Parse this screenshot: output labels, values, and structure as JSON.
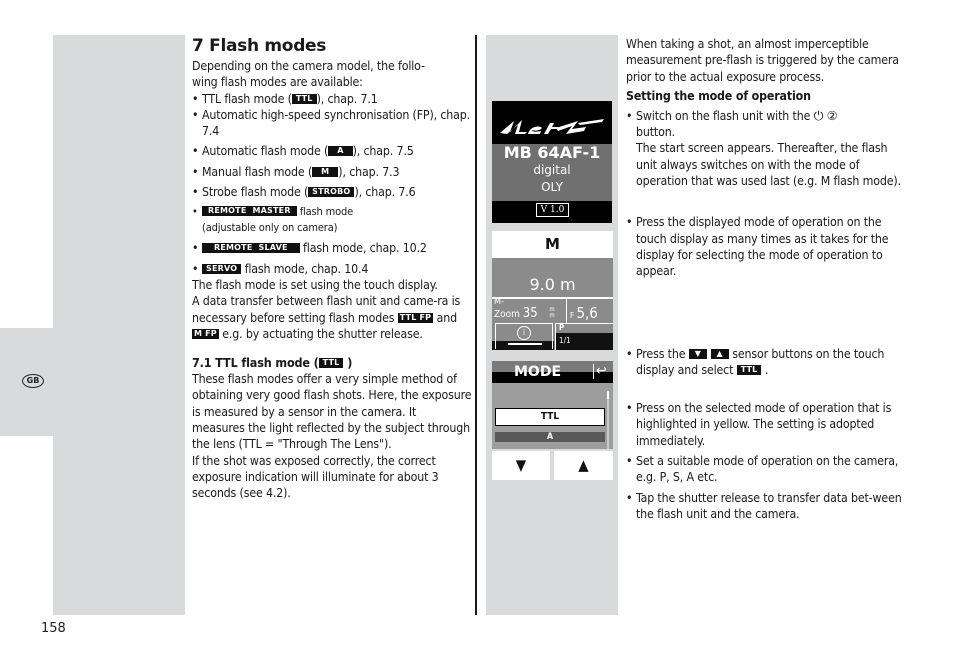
{
  "page": {
    "page_number": "158",
    "language_badge": "GB"
  },
  "left_column": {
    "title": "7 Flash modes",
    "intro_line1": "Depending on the camera model, the follo-",
    "intro_line2": "wing flash modes are available:",
    "modes": [
      {
        "before": "TTL flash mode (",
        "tag": "TTL",
        "after": "), chap. 7.1"
      },
      {
        "before": "Automatic high-speed synchronisation (FP), chap. 7.4",
        "tag": "",
        "after": ""
      },
      {
        "before": "Automatic flash mode (",
        "tag": "A",
        "after": "), chap. 7.5"
      },
      {
        "before": "Manual flash mode (",
        "tag": "M",
        "after": "), chap. 7.3"
      },
      {
        "before": "Strobe flash mode (",
        "tag": "STROBO",
        "after": "), chap. 7.6"
      },
      {
        "tag": "REMOTE  MASTER",
        "after": "flash mode",
        "note": "(adjustable only on camera)"
      },
      {
        "tag": "REMOTE  SLAVE",
        "after": "flash mode, chap. 10.2"
      },
      {
        "tag": "SERVO",
        "after": "flash mode, chap. 10.4"
      }
    ],
    "touch_text": "The flash mode is set using the touch display.",
    "transfer_text_1": "A data transfer between flash unit and came-ra is necessary before setting flash modes",
    "transfer_tag_1": "TTL FP",
    "transfer_and": "and",
    "transfer_tag_2": "M FP",
    "transfer_text_2": "e.g. by actuating the shutter release.",
    "section_title_before": "7.1 TTL flash mode (",
    "section_title_tag": "TTL",
    "section_title_after": ")",
    "section_para_1": "These flash modes offer a very simple method of obtaining very good flash shots. Here, the exposure is measured by a sensor in the camera. It measures the light reflected by the subject through the lens (TTL = \"Through The Lens\").",
    "section_para_2": "If the shot was exposed correctly, the correct exposure indication will illuminate for about 3 seconds (see 4.2)."
  },
  "screens": {
    "start": {
      "brand": "Metz",
      "model": "MB 64AF-1",
      "line1": "digital",
      "line2": "OLY",
      "version": "V 1.0"
    },
    "m_mode": {
      "mode": "M",
      "distance": "9.0 m",
      "zoom_label": "M-",
      "zoom_text": "Zoom",
      "zoom_value": "35",
      "zoom_unit_top": "m",
      "zoom_unit_bottom": "m",
      "f_label": "F",
      "f_value": "5,6",
      "info_icon": "i",
      "p_label": "P",
      "p_fraction": "1/1"
    },
    "mode_select": {
      "title": "MODE",
      "back_icon": "↩",
      "selected": "TTL",
      "next_option": "A",
      "down_icon": "▼",
      "up_icon": "▲"
    }
  },
  "right_column": {
    "intro": "When taking a shot, an almost imperceptible measurement pre-flash is triggered by the camera prior to the actual exposure process.",
    "heading": "Setting the mode of operation",
    "step1_before": "Switch on the flash unit with the",
    "step1_power_icon": "⏻",
    "step1_number": "②",
    "step1_after": "button.",
    "step1_detail": "The start screen appears. Thereafter, the flash unit always switches on with the mode of operation that was used last (e.g. M flash mode).",
    "step2": "Press the displayed mode of operation on the touch display as many times as it takes for the display for selecting the mode of operation to appear.",
    "step3_before": "Press the",
    "step3_down_icon": "▼",
    "step3_up_icon": "▲",
    "step3_middle": "sensor buttons on the touch display and select",
    "step3_tag": "TTL",
    "step3_after": ".",
    "step4": "Press on the selected mode of operation that is highlighted in yellow. The setting is adopted immediately.",
    "step5": "Set a suitable mode of operation on the camera, e.g. P, S, A etc.",
    "step6": "Tap the shutter release to transfer data bet-ween the flash unit and the camera."
  }
}
